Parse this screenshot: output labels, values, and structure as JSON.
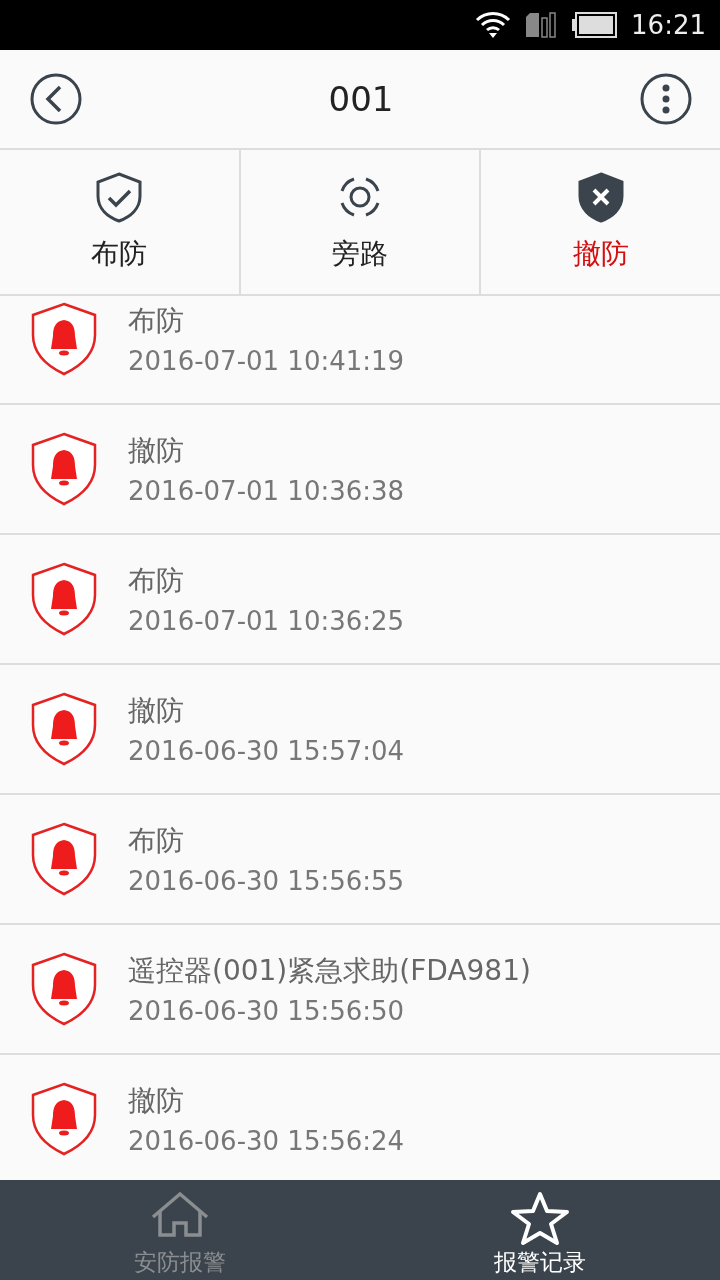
{
  "status_bar": {
    "time": "16:21"
  },
  "header": {
    "title": "001"
  },
  "modes": [
    {
      "kind": "arm",
      "label": "布防",
      "selected": false
    },
    {
      "kind": "bypass",
      "label": "旁路",
      "selected": false
    },
    {
      "kind": "disarm",
      "label": "撤防",
      "selected": true
    }
  ],
  "records": [
    {
      "event": "布防",
      "time": "2016-07-01 10:41:19"
    },
    {
      "event": "撤防",
      "time": "2016-07-01 10:36:38"
    },
    {
      "event": "布防",
      "time": "2016-07-01 10:36:25"
    },
    {
      "event": "撤防",
      "time": "2016-06-30 15:57:04"
    },
    {
      "event": "布防",
      "time": "2016-06-30 15:56:55"
    },
    {
      "event": "遥控器(001)紧急求助(FDA981)",
      "time": "2016-06-30 15:56:50"
    },
    {
      "event": "撤防",
      "time": "2016-06-30 15:56:24"
    }
  ],
  "nav": [
    {
      "kind": "home",
      "label": "安防报警",
      "selected": false
    },
    {
      "kind": "star",
      "label": "报警记录",
      "selected": true
    }
  ]
}
